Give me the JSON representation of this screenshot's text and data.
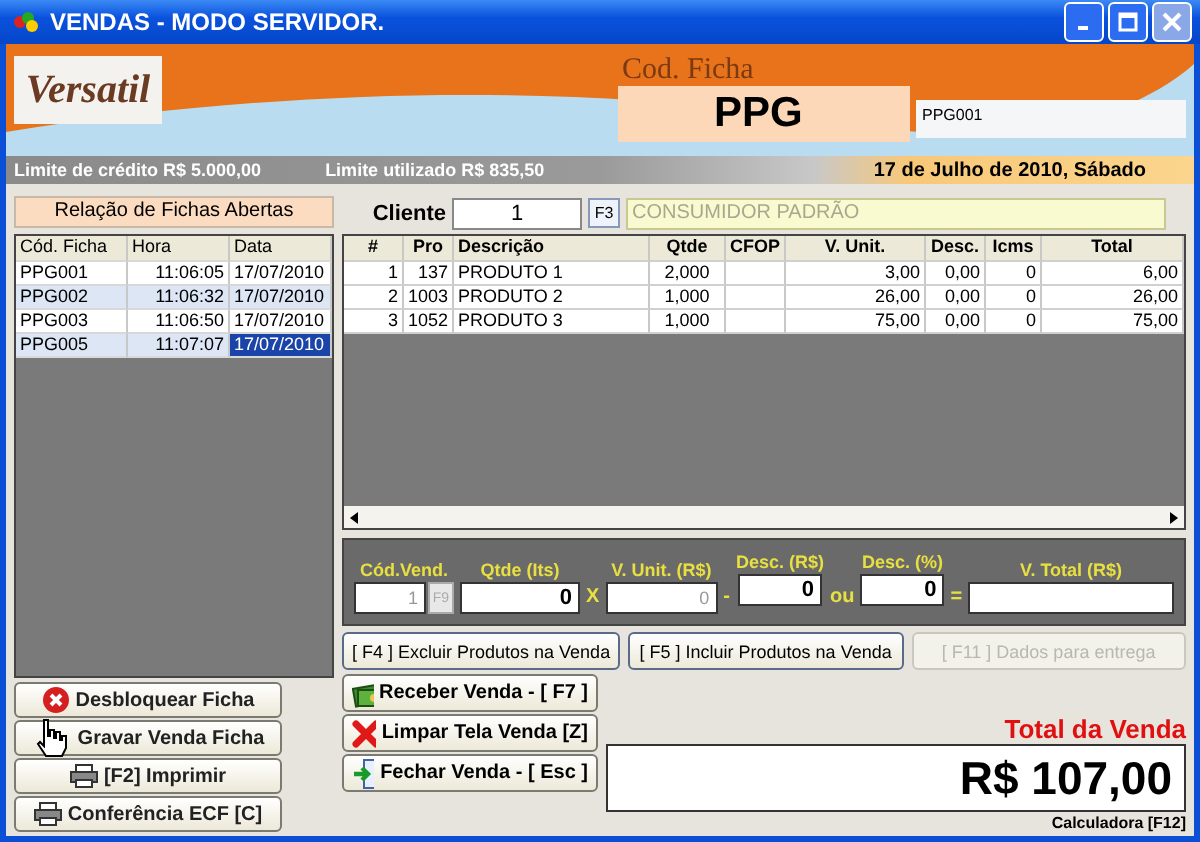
{
  "window": {
    "title": "VENDAS - MODO SERVIDOR."
  },
  "header": {
    "logo": "Versatil",
    "cod_ficha_label": "Cod. Ficha",
    "cod_ficha_value": "PPG",
    "ficha_code": "PPG001"
  },
  "info_bar": {
    "credit_limit": "Limite de crédito R$ 5.000,00",
    "used_limit": "Limite utilizado R$ 835,50",
    "date": "17 de Julho de 2010, Sábado"
  },
  "open_tickets": {
    "title": "Relação de Fichas Abertas",
    "columns": [
      "Cód. Ficha",
      "Hora",
      "Data"
    ],
    "rows": [
      {
        "cells": [
          "PPG001",
          "11:06:05",
          "17/07/2010"
        ],
        "selected": false
      },
      {
        "cells": [
          "PPG002",
          "11:06:32",
          "17/07/2010"
        ],
        "selected": false
      },
      {
        "cells": [
          "PPG003",
          "11:06:50",
          "17/07/2010"
        ],
        "selected": false
      },
      {
        "cells": [
          "PPG005",
          "11:07:07",
          "17/07/2010"
        ],
        "selected": true
      }
    ]
  },
  "client": {
    "label": "Cliente",
    "value": "1",
    "lookup_key": "F3",
    "name": "CONSUMIDOR PADRÃO"
  },
  "items": {
    "columns": [
      "#",
      "Pro",
      "Descrição",
      "Qtde",
      "CFOP",
      "V. Unit.",
      "Desc.",
      "Icms",
      "Total"
    ],
    "rows": [
      [
        "1",
        "137",
        "PRODUTO 1",
        "2,000",
        "",
        "3,00",
        "0,00",
        "0",
        "6,00"
      ],
      [
        "2",
        "1003",
        "PRODUTO 2",
        "1,000",
        "",
        "26,00",
        "0,00",
        "0",
        "26,00"
      ],
      [
        "3",
        "1052",
        "PRODUTO 3",
        "1,000",
        "",
        "75,00",
        "0,00",
        "0",
        "75,00"
      ]
    ]
  },
  "entry": {
    "seller_label": "Cód.Vend.",
    "seller_value": "1",
    "seller_key": "F9",
    "qty_label": "Qtde (Its)",
    "qty_value": "0",
    "times": "X",
    "unit_label": "V. Unit. (R$)",
    "unit_value": "0",
    "minus": "-",
    "disc_label": "Desc. (R$)",
    "disc_value": "0",
    "or": "ou",
    "disc_pct_label": "Desc. (%)",
    "disc_pct_value": "0",
    "equals": "=",
    "total_label": "V. Total (R$)"
  },
  "item_actions": [
    {
      "label": "[ F4 ] Excluir Produtos na Venda",
      "disabled": false
    },
    {
      "label": "[ F5 ] Incluir Produtos na Venda",
      "disabled": false
    },
    {
      "label": "[ F11 ] Dados para entrega",
      "disabled": true
    }
  ],
  "left_buttons": [
    {
      "kind": "unlock",
      "label": "Desbloquear Ficha"
    },
    {
      "kind": "save",
      "label": "Gravar Venda Ficha"
    },
    {
      "kind": "print",
      "label": "[F2] Imprimir"
    },
    {
      "kind": "print",
      "label": "Conferência ECF [C]"
    }
  ],
  "sale_buttons": [
    {
      "kind": "receive",
      "label": "Receber Venda - [ F7 ]"
    },
    {
      "kind": "clear",
      "label": "Limpar Tela Venda [Z]"
    },
    {
      "kind": "close",
      "label": "Fechar Venda - [ Esc ]"
    }
  ],
  "total": {
    "label": "Total da Venda",
    "value": "R$ 107,00",
    "calculator": "Calculadora [F12]"
  }
}
